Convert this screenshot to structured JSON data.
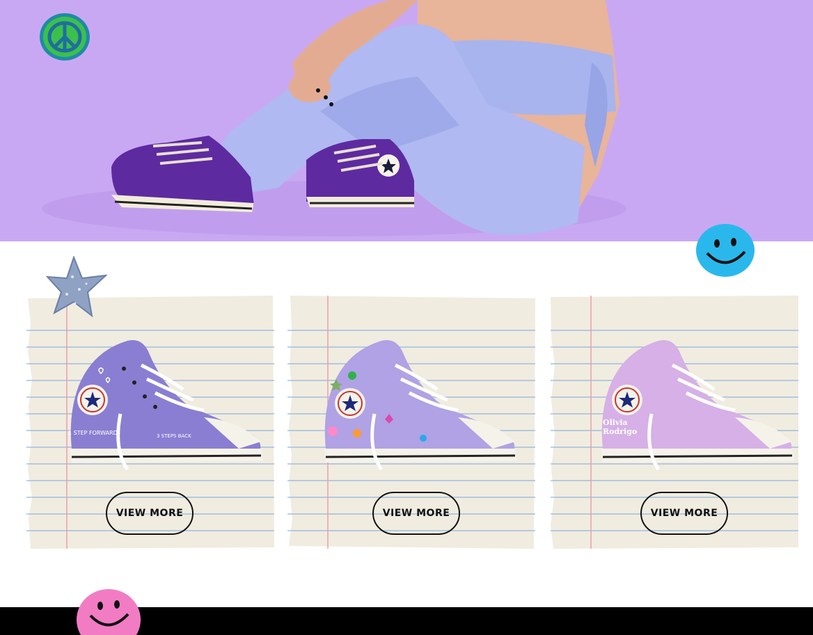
{
  "hero": {
    "image": "girl-in-lavender-outfit-with-purple-converse",
    "background_color": "#c9a8f3"
  },
  "stickers": {
    "peace": "peace-sign-sticker",
    "star": "glitter-star-sticker",
    "smiley_blue": "blue-smiley-sticker",
    "smiley_pink": "pink-smiley-sticker"
  },
  "products": [
    {
      "shoe_color": "#8a7ed2",
      "shoe_text_left": "1 STEP FORWARD",
      "shoe_text_right": "3 STEPS BACK",
      "button_label": "VIEW MORE"
    },
    {
      "shoe_color": "#b0a2e4",
      "button_label": "VIEW MORE"
    },
    {
      "shoe_color": "#d6b0e6",
      "shoe_text_name": "Olivia Rodrigo",
      "shoe_text_line1": "Olivia",
      "shoe_text_line2": "Rodrigo",
      "button_label": "VIEW MORE"
    }
  ],
  "footer": {
    "background_color": "#000000"
  }
}
